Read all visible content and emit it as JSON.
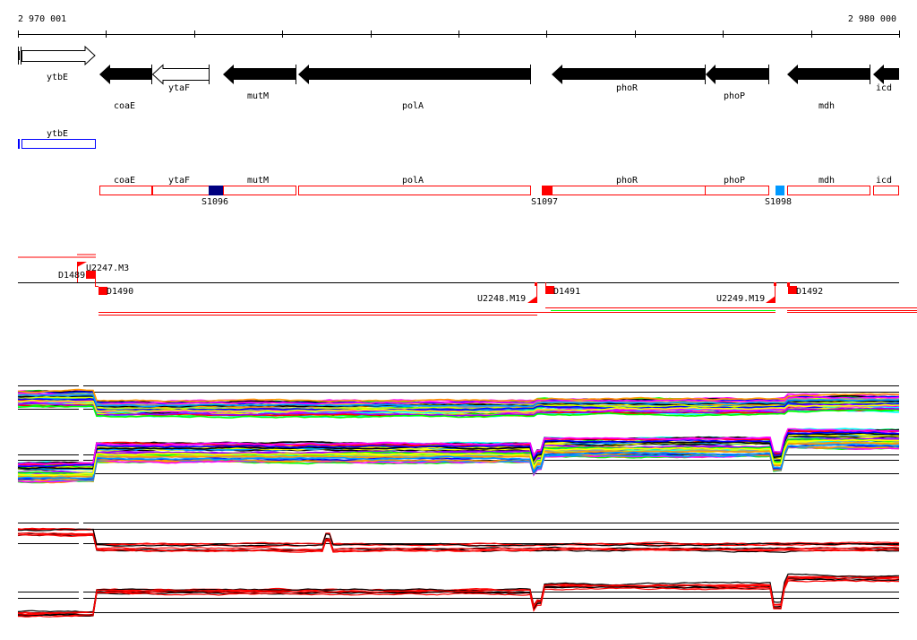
{
  "ruler": {
    "start_label": "2 970 001",
    "end_label": "2 980 000"
  },
  "genes": [
    {
      "name": "ytbE",
      "strand": "+"
    },
    {
      "name": "coaE",
      "strand": "-"
    },
    {
      "name": "ytaF",
      "strand": "-"
    },
    {
      "name": "mutM",
      "strand": "-"
    },
    {
      "name": "polA",
      "strand": "-"
    },
    {
      "name": "phoR",
      "strand": "-"
    },
    {
      "name": "phoP",
      "strand": "-"
    },
    {
      "name": "mdh",
      "strand": "-"
    },
    {
      "name": "icd",
      "strand": "-"
    }
  ],
  "operon_track": {
    "blue_feature": "ytbE",
    "red_features": [
      "coaE",
      "ytaF",
      "mutM",
      "polA",
      "phoR",
      "phoP",
      "mdh",
      "icd"
    ],
    "sites": [
      {
        "label": "S1096",
        "color": "#000080"
      },
      {
        "label": "S1097",
        "color": "#ff0000"
      },
      {
        "label": "S1098",
        "color": "#0099ff"
      }
    ]
  },
  "regulation_track": {
    "down_marks": [
      "D1489",
      "D1490",
      "D1491",
      "D1492"
    ],
    "up_marks": [
      "U2247.M3",
      "U2248.M19",
      "U2249.M19"
    ]
  },
  "colors": {
    "accent": "#ff0000",
    "blue": "#0000ff",
    "green": "#00ff00"
  }
}
